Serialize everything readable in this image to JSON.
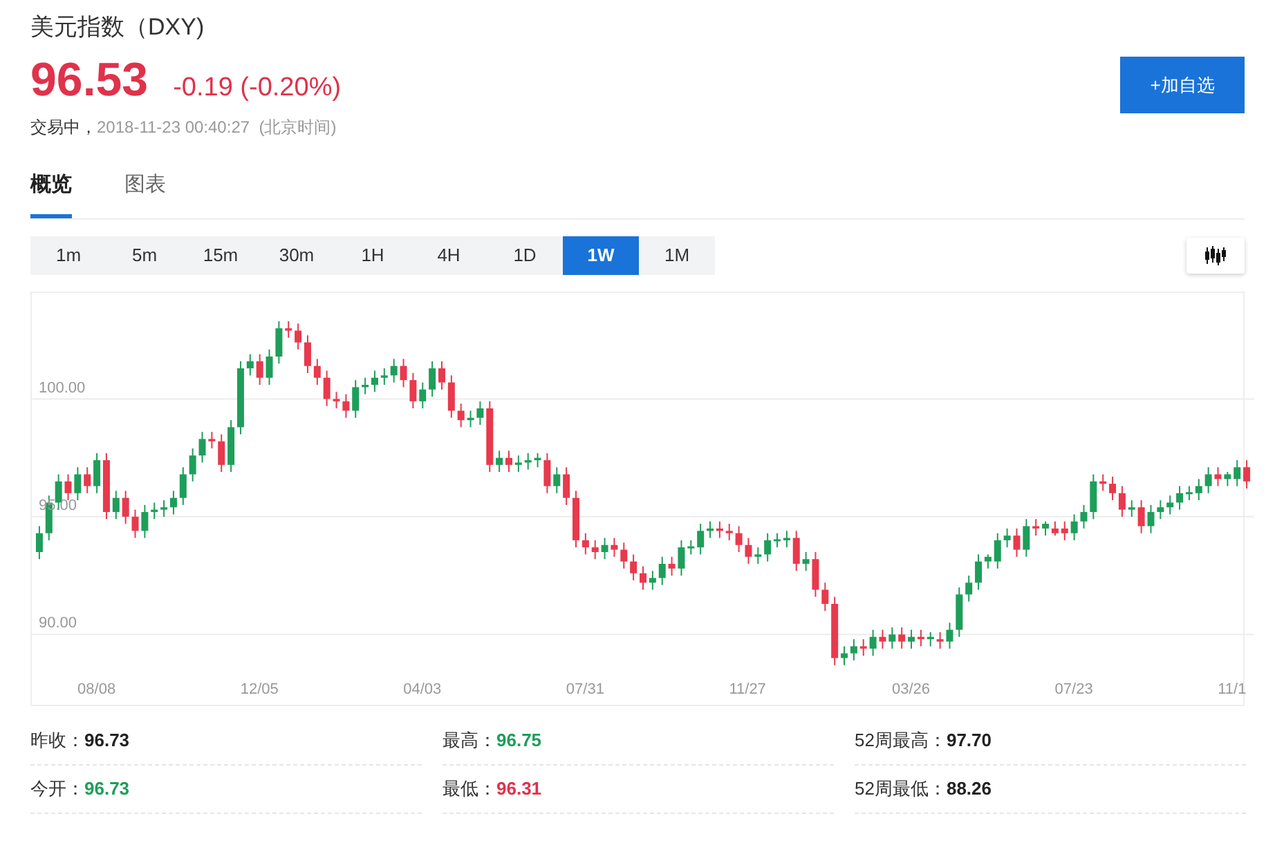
{
  "header": {
    "title": "美元指数（DXY)",
    "price": "96.53",
    "change": "-0.19 (-0.20%)",
    "status": "交易中，",
    "time": "2018-11-23 00:40:27  (北京时间)",
    "add_button": "+加自选"
  },
  "tabs": [
    {
      "label": "概览",
      "selected": true
    },
    {
      "label": "图表",
      "selected": false
    }
  ],
  "intervals": [
    {
      "label": "1m",
      "selected": false
    },
    {
      "label": "5m",
      "selected": false
    },
    {
      "label": "15m",
      "selected": false
    },
    {
      "label": "30m",
      "selected": false
    },
    {
      "label": "1H",
      "selected": false
    },
    {
      "label": "4H",
      "selected": false
    },
    {
      "label": "1D",
      "selected": false
    },
    {
      "label": "1W",
      "selected": true
    },
    {
      "label": "1M",
      "selected": false
    }
  ],
  "chart": {
    "chart_data": {
      "type": "candlestick",
      "grid": true,
      "ylim": [
        86.9,
        104.5
      ],
      "yticks": [
        {
          "value": 90,
          "label": "90.00"
        },
        {
          "value": 95,
          "label": "95.00"
        },
        {
          "value": 100,
          "label": "100.00"
        }
      ],
      "categories": [
        null,
        null,
        null,
        null,
        null,
        null,
        "08/08",
        null,
        null,
        null,
        null,
        null,
        null,
        null,
        null,
        null,
        null,
        null,
        null,
        null,
        null,
        null,
        null,
        "12/05",
        null,
        null,
        null,
        null,
        null,
        null,
        null,
        null,
        null,
        null,
        null,
        null,
        null,
        null,
        null,
        null,
        "04/03",
        null,
        null,
        null,
        null,
        null,
        null,
        null,
        null,
        null,
        null,
        null,
        null,
        null,
        null,
        null,
        null,
        "07/31",
        null,
        null,
        null,
        null,
        null,
        null,
        null,
        null,
        null,
        null,
        null,
        null,
        null,
        null,
        null,
        null,
        "11/27",
        null,
        null,
        null,
        null,
        null,
        null,
        null,
        null,
        null,
        null,
        null,
        null,
        null,
        null,
        null,
        null,
        "03/26",
        null,
        null,
        null,
        null,
        null,
        null,
        null,
        null,
        null,
        null,
        null,
        null,
        null,
        null,
        null,
        null,
        "07/23",
        null,
        null,
        null,
        null,
        null,
        null,
        null,
        null,
        null,
        null,
        null,
        null,
        null,
        null,
        null,
        null,
        "11/1",
        null
      ],
      "ohlc": [
        [
          93.5,
          94.6,
          93.2,
          94.3
        ],
        [
          94.3,
          95.9,
          94.0,
          95.6
        ],
        [
          95.6,
          96.8,
          95.3,
          96.5
        ],
        [
          96.5,
          96.8,
          95.7,
          96.0
        ],
        [
          96.0,
          97.1,
          95.7,
          96.8
        ],
        [
          96.8,
          97.1,
          96.0,
          96.3
        ],
        [
          96.3,
          97.7,
          96.0,
          97.4
        ],
        [
          97.4,
          97.7,
          94.9,
          95.2
        ],
        [
          95.2,
          96.1,
          94.9,
          95.8
        ],
        [
          95.8,
          96.1,
          94.7,
          95.0
        ],
        [
          95.0,
          95.3,
          94.1,
          94.4
        ],
        [
          94.4,
          95.5,
          94.1,
          95.2
        ],
        [
          95.2,
          95.6,
          94.9,
          95.3
        ],
        [
          95.3,
          95.7,
          95.0,
          95.4
        ],
        [
          95.4,
          96.1,
          95.1,
          95.8
        ],
        [
          95.8,
          97.1,
          95.5,
          96.8
        ],
        [
          96.8,
          97.9,
          96.5,
          97.6
        ],
        [
          97.6,
          98.6,
          97.3,
          98.3
        ],
        [
          98.3,
          98.6,
          97.9,
          98.2
        ],
        [
          98.2,
          98.5,
          96.9,
          97.2
        ],
        [
          97.2,
          99.1,
          96.9,
          98.8
        ],
        [
          98.8,
          101.6,
          98.5,
          101.3
        ],
        [
          101.3,
          101.9,
          101.0,
          101.6
        ],
        [
          101.6,
          101.9,
          100.6,
          100.9
        ],
        [
          100.9,
          102.1,
          100.6,
          101.8
        ],
        [
          101.8,
          103.3,
          101.5,
          103.0
        ],
        [
          103.0,
          103.3,
          102.6,
          102.9
        ],
        [
          102.9,
          103.2,
          102.1,
          102.4
        ],
        [
          102.4,
          102.7,
          101.1,
          101.4
        ],
        [
          101.4,
          101.7,
          100.6,
          100.9
        ],
        [
          100.9,
          101.2,
          99.7,
          100.0
        ],
        [
          100.0,
          100.3,
          99.6,
          99.9
        ],
        [
          99.9,
          100.2,
          99.2,
          99.5
        ],
        [
          99.5,
          100.8,
          99.2,
          100.5
        ],
        [
          100.5,
          100.9,
          100.2,
          100.6
        ],
        [
          100.6,
          101.2,
          100.3,
          100.9
        ],
        [
          100.9,
          101.3,
          100.6,
          101.0
        ],
        [
          101.0,
          101.7,
          100.7,
          101.4
        ],
        [
          101.4,
          101.7,
          100.5,
          100.8
        ],
        [
          100.8,
          101.1,
          99.6,
          99.9
        ],
        [
          99.9,
          100.7,
          99.6,
          100.4
        ],
        [
          100.4,
          101.6,
          100.1,
          101.3
        ],
        [
          101.3,
          101.6,
          100.4,
          100.7
        ],
        [
          100.7,
          101.0,
          99.2,
          99.5
        ],
        [
          99.5,
          99.8,
          98.8,
          99.1
        ],
        [
          99.1,
          99.5,
          98.8,
          99.2
        ],
        [
          99.2,
          99.9,
          98.9,
          99.6
        ],
        [
          99.6,
          99.9,
          96.9,
          97.2
        ],
        [
          97.2,
          97.8,
          96.9,
          97.5
        ],
        [
          97.5,
          97.8,
          96.9,
          97.2
        ],
        [
          97.2,
          97.6,
          96.9,
          97.3
        ],
        [
          97.3,
          97.7,
          97.0,
          97.4
        ],
        [
          97.4,
          97.7,
          97.1,
          97.5
        ],
        [
          97.4,
          97.7,
          96.0,
          96.3
        ],
        [
          96.3,
          97.1,
          96.0,
          96.8
        ],
        [
          96.8,
          97.1,
          95.5,
          95.8
        ],
        [
          95.8,
          96.1,
          93.7,
          94.0
        ],
        [
          94.0,
          94.3,
          93.4,
          93.7
        ],
        [
          93.7,
          94.0,
          93.2,
          93.5
        ],
        [
          93.5,
          94.1,
          93.2,
          93.8
        ],
        [
          93.8,
          94.1,
          93.3,
          93.6
        ],
        [
          93.6,
          93.9,
          92.8,
          93.1
        ],
        [
          93.1,
          93.4,
          92.3,
          92.6
        ],
        [
          92.6,
          92.9,
          91.9,
          92.2
        ],
        [
          92.2,
          92.7,
          91.9,
          92.4
        ],
        [
          92.4,
          93.3,
          92.1,
          93.0
        ],
        [
          93.0,
          93.3,
          92.5,
          92.8
        ],
        [
          92.8,
          94.0,
          92.5,
          93.7
        ],
        [
          93.7,
          94.0,
          93.4,
          93.7
        ],
        [
          93.7,
          94.7,
          93.4,
          94.4
        ],
        [
          94.4,
          94.8,
          94.1,
          94.5
        ],
        [
          94.5,
          94.8,
          94.1,
          94.4
        ],
        [
          94.4,
          94.7,
          94.0,
          94.3
        ],
        [
          94.3,
          94.6,
          93.5,
          93.8
        ],
        [
          93.8,
          94.1,
          93.0,
          93.3
        ],
        [
          93.3,
          93.7,
          93.0,
          93.4
        ],
        [
          93.4,
          94.3,
          93.1,
          94.0
        ],
        [
          94.0,
          94.3,
          93.7,
          94.0
        ],
        [
          94.0,
          94.4,
          93.7,
          94.1
        ],
        [
          94.1,
          94.4,
          92.7,
          93.0
        ],
        [
          93.0,
          93.5,
          92.7,
          93.2
        ],
        [
          93.2,
          93.5,
          91.6,
          91.9
        ],
        [
          91.9,
          92.2,
          91.0,
          91.3
        ],
        [
          91.3,
          91.6,
          88.7,
          89.0
        ],
        [
          89.0,
          89.5,
          88.7,
          89.2
        ],
        [
          89.2,
          89.8,
          88.9,
          89.5
        ],
        [
          89.5,
          89.8,
          89.1,
          89.4
        ],
        [
          89.4,
          90.2,
          89.1,
          89.9
        ],
        [
          89.9,
          90.2,
          89.4,
          89.7
        ],
        [
          89.7,
          90.3,
          89.4,
          90.0
        ],
        [
          90.0,
          90.3,
          89.4,
          89.7
        ],
        [
          89.7,
          90.2,
          89.4,
          89.9
        ],
        [
          89.9,
          90.2,
          89.5,
          89.8
        ],
        [
          89.8,
          90.1,
          89.5,
          89.9
        ],
        [
          89.8,
          90.1,
          89.4,
          89.7
        ],
        [
          89.7,
          90.5,
          89.4,
          90.2
        ],
        [
          90.2,
          92.0,
          89.9,
          91.7
        ],
        [
          91.7,
          92.5,
          91.4,
          92.2
        ],
        [
          92.2,
          93.4,
          91.9,
          93.1
        ],
        [
          93.1,
          93.4,
          92.8,
          93.3
        ],
        [
          93.1,
          94.3,
          92.8,
          94.0
        ],
        [
          94.0,
          94.5,
          93.7,
          94.2
        ],
        [
          94.2,
          94.5,
          93.3,
          93.6
        ],
        [
          93.6,
          94.9,
          93.3,
          94.6
        ],
        [
          94.6,
          94.9,
          94.2,
          94.5
        ],
        [
          94.5,
          94.8,
          94.2,
          94.7
        ],
        [
          94.5,
          94.8,
          94.2,
          94.3
        ],
        [
          94.5,
          94.8,
          94.0,
          94.3
        ],
        [
          94.3,
          95.1,
          94.0,
          94.8
        ],
        [
          94.8,
          95.5,
          94.5,
          95.2
        ],
        [
          95.2,
          96.8,
          94.9,
          96.5
        ],
        [
          96.5,
          96.8,
          96.1,
          96.4
        ],
        [
          96.4,
          96.7,
          95.7,
          96.0
        ],
        [
          96.0,
          96.3,
          95.0,
          95.3
        ],
        [
          95.3,
          95.7,
          95.0,
          95.4
        ],
        [
          95.4,
          95.7,
          94.3,
          94.6
        ],
        [
          94.6,
          95.5,
          94.3,
          95.2
        ],
        [
          95.2,
          95.7,
          94.9,
          95.4
        ],
        [
          95.4,
          95.9,
          95.1,
          95.6
        ],
        [
          95.6,
          96.3,
          95.3,
          96.0
        ],
        [
          96.0,
          96.3,
          95.7,
          96.0
        ],
        [
          96.0,
          96.6,
          95.7,
          96.3
        ],
        [
          96.3,
          97.1,
          96.0,
          96.8
        ],
        [
          96.8,
          97.1,
          96.3,
          96.6
        ],
        [
          96.6,
          96.9,
          96.3,
          96.8
        ],
        [
          96.6,
          97.4,
          96.3,
          97.1
        ],
        [
          97.1,
          97.4,
          96.2,
          96.5
        ]
      ]
    }
  },
  "stats": [
    {
      "label": "昨收：",
      "value": "96.73",
      "color": "#222222"
    },
    {
      "label": "最高：",
      "value": "96.75",
      "color": "#1e9e5a"
    },
    {
      "label": "52周最高：",
      "value": "97.70",
      "color": "#222222"
    },
    {
      "label": "今开：",
      "value": "96.73",
      "color": "#1e9e5a"
    },
    {
      "label": "最低：",
      "value": "96.31",
      "color": "#e0324b"
    },
    {
      "label": "52周最低：",
      "value": "88.26",
      "color": "#222222"
    }
  ]
}
